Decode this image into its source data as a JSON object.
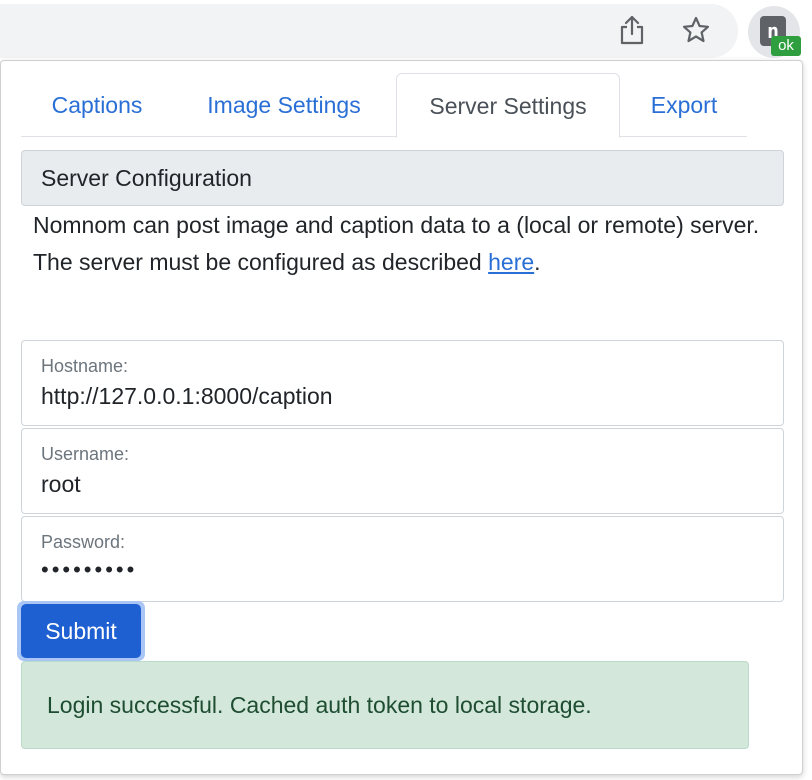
{
  "tabs": [
    {
      "label": "Captions"
    },
    {
      "label": "Image Settings"
    },
    {
      "label": "Server Settings"
    },
    {
      "label": "Export"
    }
  ],
  "extension": {
    "badge": "ok",
    "icon_letter": "n"
  },
  "section": {
    "title": "Server Configuration"
  },
  "description": {
    "text": "Nomnom can post image and caption data to a (local or remote) server. The server must be configured as described ",
    "link": "here",
    "suffix": "."
  },
  "fields": {
    "hostname": {
      "label": "Hostname:",
      "value": "http://127.0.0.1:8000/caption"
    },
    "username": {
      "label": "Username:",
      "value": "root"
    },
    "password": {
      "label": "Password:",
      "value": "•••••••••"
    }
  },
  "submit": {
    "label": "Submit"
  },
  "alert": {
    "message": "Login successful. Cached auth token to local storage."
  },
  "colors": {
    "link": "#2a6fd6",
    "primary": "#1e5fd1",
    "success_bg": "#d3e7db",
    "badge": "#2e9e3f"
  }
}
